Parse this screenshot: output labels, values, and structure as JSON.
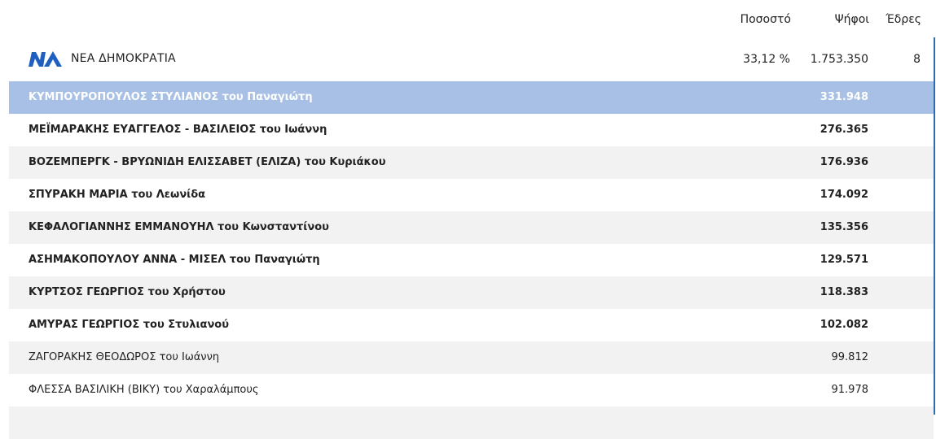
{
  "columns": {
    "percent": "Ποσοστό",
    "votes": "Ψήφοι",
    "seats": "Έδρες"
  },
  "party": {
    "logo_icon": "nd-party-logo",
    "logo_text": "ΝΔ",
    "name": "ΝΕΑ ΔΗΜΟΚΡΑΤΙΑ",
    "percent": "33,12 %",
    "votes": "1.753.350",
    "seats": "8"
  },
  "colors": {
    "highlight_row": "#a8c0e6",
    "alt_row": "#f2f2f2",
    "accent": "#2f6ab5",
    "logo_blue": "#1f5fbf"
  },
  "candidates": [
    {
      "name": "ΚΥΜΠΟΥΡΟΠΟΥΛΟΣ ΣΤΥΛΙΑΝΟΣ του Παναγιώτη",
      "votes": "331.948"
    },
    {
      "name": "ΜΕΪΜΑΡΑΚΗΣ ΕΥΑΓΓΕΛΟΣ - ΒΑΣΙΛΕΙΟΣ του Ιωάννη",
      "votes": "276.365"
    },
    {
      "name": "ΒΟΖΕΜΠΕΡΓΚ - ΒΡΥΩΝΙΔΗ ΕΛΙΣΣΑΒΕΤ (ΕΛΙΖΑ) του Κυριάκου",
      "votes": "176.936"
    },
    {
      "name": "ΣΠΥΡΑΚΗ ΜΑΡΙΑ του Λεωνίδα",
      "votes": "174.092"
    },
    {
      "name": "ΚΕΦΑΛΟΓΙΑΝΝΗΣ ΕΜΜΑΝΟΥΗΛ του Κωνσταντίνου",
      "votes": "135.356"
    },
    {
      "name": "ΑΣΗΜΑΚΟΠΟΥΛΟΥ ΑΝΝΑ - ΜΙΣΕΛ του Παναγιώτη",
      "votes": "129.571"
    },
    {
      "name": "ΚΥΡΤΣΟΣ ΓΕΩΡΓΙΟΣ του Χρήστου",
      "votes": "118.383"
    },
    {
      "name": "ΑΜΥΡΑΣ ΓΕΩΡΓΙΟΣ του Στυλιανού",
      "votes": "102.082"
    },
    {
      "name": "ΖΑΓΟΡΑΚΗΣ ΘΕΟΔΩΡΟΣ του Ιωάννη",
      "votes": "99.812"
    },
    {
      "name": "ΦΛΕΣΣΑ ΒΑΣΙΛΙΚΗ (ΒΙΚΥ) του Χαραλάμπους",
      "votes": "91.978"
    }
  ]
}
